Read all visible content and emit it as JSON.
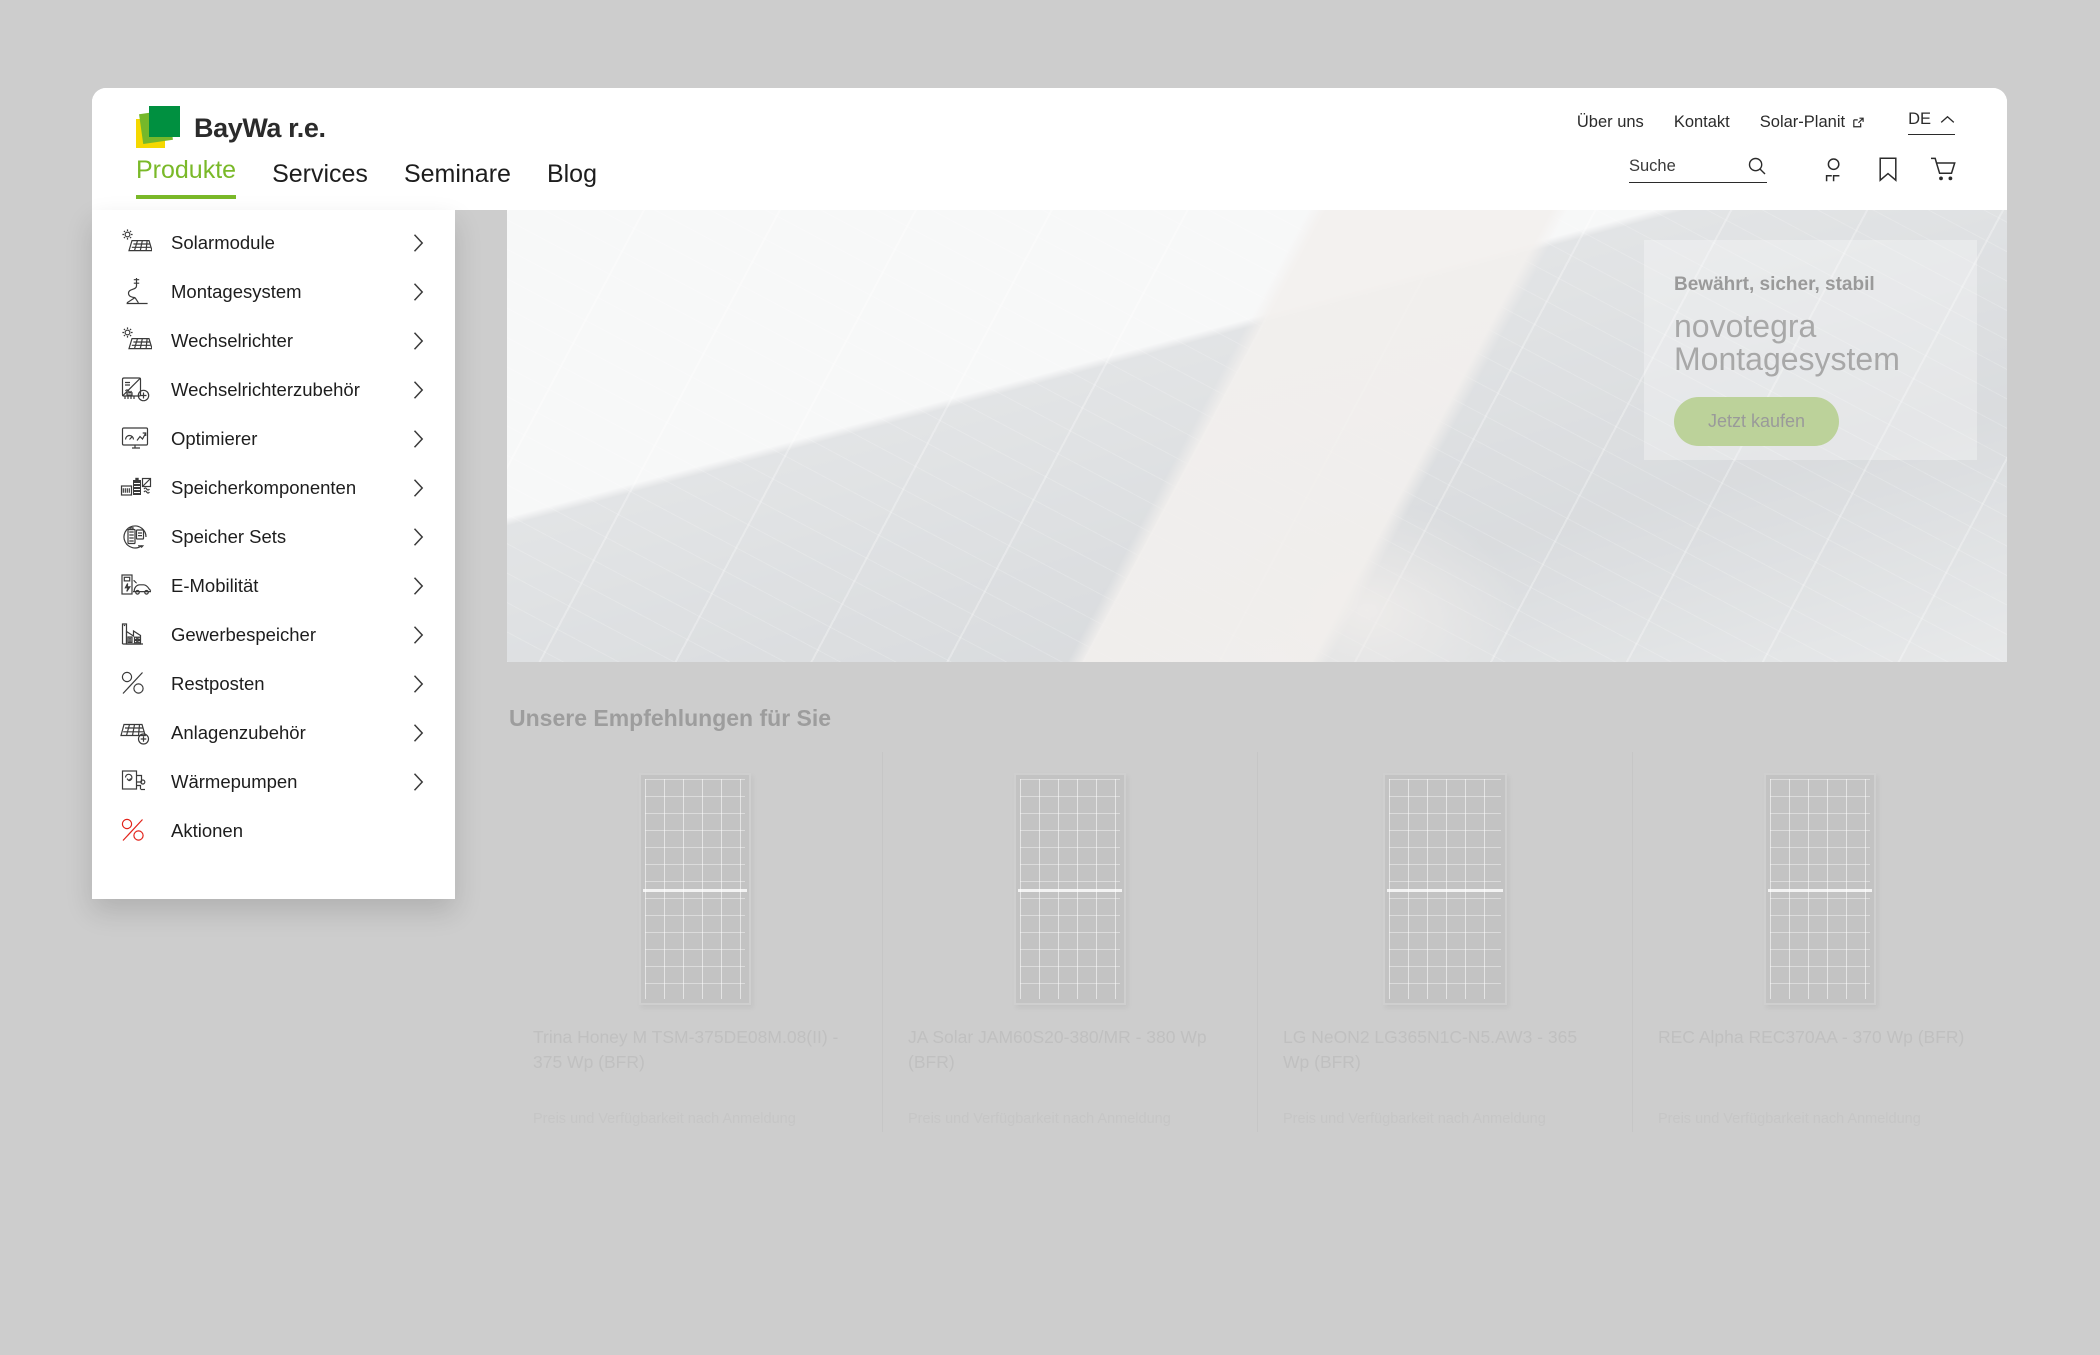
{
  "brand": {
    "logo_text": "BayWa r.e.",
    "logo_colors": {
      "yellow": "#f5d800",
      "light_green": "#75b82a",
      "dark_green": "#009040"
    },
    "accent_green": "#7ab929",
    "accent_red": "#e2231a"
  },
  "utility_nav": {
    "items": [
      {
        "label": "Über uns",
        "icon": null
      },
      {
        "label": "Kontakt",
        "icon": null
      },
      {
        "label": "Solar-Planit",
        "icon": "external-link-icon"
      }
    ],
    "language": {
      "label": "DE",
      "icon": "chevron-up-icon"
    }
  },
  "main_nav": {
    "items": [
      {
        "label": "Produkte",
        "active": true
      },
      {
        "label": "Services",
        "active": false
      },
      {
        "label": "Seminare",
        "active": false
      },
      {
        "label": "Blog",
        "active": false
      }
    ]
  },
  "header_tools": {
    "search": {
      "placeholder": "Suche",
      "value": "",
      "icon": "search-icon"
    },
    "icons": [
      {
        "name": "user-account-icon"
      },
      {
        "name": "bookmark-icon"
      },
      {
        "name": "shopping-cart-icon"
      }
    ]
  },
  "flyout": {
    "items": [
      {
        "label": "Solarmodule",
        "icon": "solar-panel-icon",
        "chevron": true
      },
      {
        "label": "Montagesystem",
        "icon": "mounting-rail-icon",
        "chevron": true
      },
      {
        "label": "Wechselrichter",
        "icon": "solar-panel-icon",
        "chevron": true
      },
      {
        "label": "Wechselrichterzubehör",
        "icon": "inverter-plus-icon",
        "chevron": true
      },
      {
        "label": "Optimierer",
        "icon": "monitor-chart-icon",
        "chevron": true
      },
      {
        "label": "Speicherkomponenten",
        "icon": "battery-components-icon",
        "chevron": true
      },
      {
        "label": "Speicher Sets",
        "icon": "battery-set-circle-icon",
        "chevron": true
      },
      {
        "label": "E-Mobilität",
        "icon": "ev-charging-icon",
        "chevron": true
      },
      {
        "label": "Gewerbespeicher",
        "icon": "factory-battery-icon",
        "chevron": true
      },
      {
        "label": "Restposten",
        "icon": "percent-icon",
        "chevron": true
      },
      {
        "label": "Anlagenzubehör",
        "icon": "panel-plus-icon",
        "chevron": true
      },
      {
        "label": "Wärmepumpen",
        "icon": "heat-pump-icon",
        "chevron": true
      },
      {
        "label": "Aktionen",
        "icon": "percent-red-icon",
        "chevron": false
      }
    ]
  },
  "hero": {
    "kicker": "Bewährt, sicher, stabil",
    "title_line1": "novotegra",
    "title_line2": "Montagesystem",
    "cta_label": "Jetzt kaufen",
    "cta_color": "#bcd29a"
  },
  "recommendations": {
    "heading": "Unsere Empfehlungen für Sie",
    "products": [
      {
        "name": "Trina Honey M TSM-375DE08M.08(II) - 375 Wp (BFR)",
        "note": "Preis und Verfügbarkeit nach Anmeldung"
      },
      {
        "name": "JA Solar JAM60S20-380/MR - 380 Wp (BFR)",
        "note": "Preis und Verfügbarkeit nach Anmeldung"
      },
      {
        "name": "LG NeON2 LG365N1C-N5.AW3 - 365 Wp (BFR)",
        "note": "Preis und Verfügbarkeit nach Anmeldung"
      },
      {
        "name": "REC Alpha REC370AA - 370 Wp (BFR)",
        "note": "Preis und Verfügbarkeit nach Anmeldung"
      }
    ]
  }
}
